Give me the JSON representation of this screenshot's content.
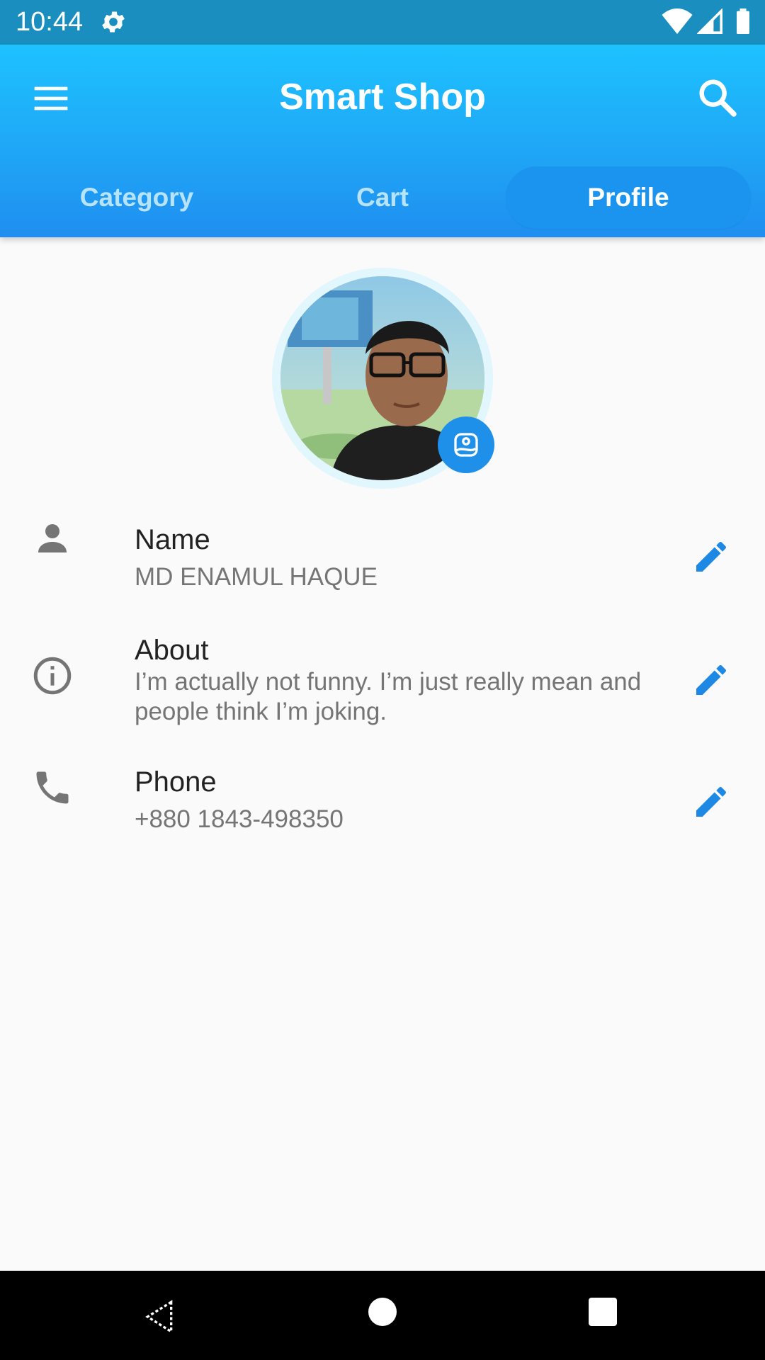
{
  "status_bar": {
    "time": "10:44",
    "icons": [
      "gear-icon",
      "wifi-icon",
      "signal-icon",
      "battery-icon"
    ]
  },
  "app_bar": {
    "title": "Smart Shop",
    "menu_icon": "hamburger-menu-icon",
    "search_icon": "search-icon",
    "background_colors": [
      "#1ec2ff",
      "#1f8ef0"
    ]
  },
  "tabs": [
    {
      "label": "Category",
      "active": false
    },
    {
      "label": "Cart",
      "active": false
    },
    {
      "label": "Profile",
      "active": true
    }
  ],
  "profile": {
    "avatar_edit_icon": "image-edit-icon",
    "rows": [
      {
        "icon": "person-icon",
        "label": "Name",
        "value": "MD ENAMUL HAQUE"
      },
      {
        "icon": "info-icon",
        "label": "About",
        "value": "I’m actually not funny. I’m just really mean and people think I’m joking."
      },
      {
        "icon": "phone-icon",
        "label": "Phone",
        "value": "+880 1843-498350"
      }
    ],
    "edit_icon": "pencil-edit-icon",
    "accent_color": "#1e88e5"
  },
  "nav_bar": {
    "icons": [
      "back-icon",
      "home-icon",
      "recents-icon"
    ]
  }
}
